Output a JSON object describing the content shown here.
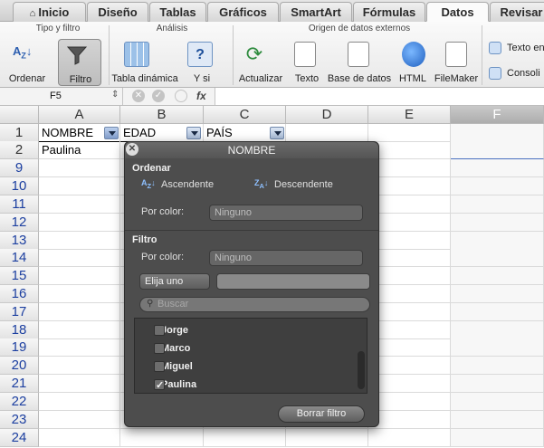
{
  "tabs": [
    "Inicio",
    "Diseño",
    "Tablas",
    "Gráficos",
    "SmartArt",
    "Fórmulas",
    "Datos",
    "Revisar"
  ],
  "ribbon": {
    "groups": {
      "sort_filter": "Tipo y filtro",
      "analysis": "Análisis",
      "external": "Origen de datos externos"
    },
    "buttons": {
      "sort": "Ordenar",
      "filter": "Filtro",
      "pivot": "Tabla dinámica",
      "whatif": "Y si",
      "refresh": "Actualizar",
      "text": "Texto",
      "database": "Base de datos",
      "html": "HTML",
      "filemaker": "FileMaker",
      "text_cols": "Texto en",
      "consolidate": "Consoli"
    }
  },
  "formula_bar": {
    "name_box": "F5",
    "fx": "fx"
  },
  "columns": [
    "A",
    "B",
    "C",
    "D",
    "E",
    "F"
  ],
  "rows": [
    "1",
    "2",
    "9",
    "10",
    "11",
    "12",
    "13",
    "14",
    "15",
    "16",
    "17",
    "18",
    "19",
    "20",
    "21",
    "22",
    "23",
    "24"
  ],
  "cells": {
    "a1": "NOMBRE",
    "b1": "EDAD",
    "c1": "PAÍS",
    "a2": "Paulina"
  },
  "popup": {
    "title": "NOMBRE",
    "sort_section": "Ordenar",
    "ascending": "Ascendente",
    "descending": "Descendente",
    "by_color_label": "Por color:",
    "sort_color_value": "Ninguno",
    "filter_section": "Filtro",
    "filter_color_value": "Ninguno",
    "choose": "Elija uno",
    "search_placeholder": "Buscar",
    "items": [
      {
        "label": "Jorge",
        "checked": false
      },
      {
        "label": "Marco",
        "checked": false
      },
      {
        "label": "Miguel",
        "checked": false
      },
      {
        "label": "Paulina",
        "checked": true
      }
    ],
    "clear_filter": "Borrar filtro"
  }
}
